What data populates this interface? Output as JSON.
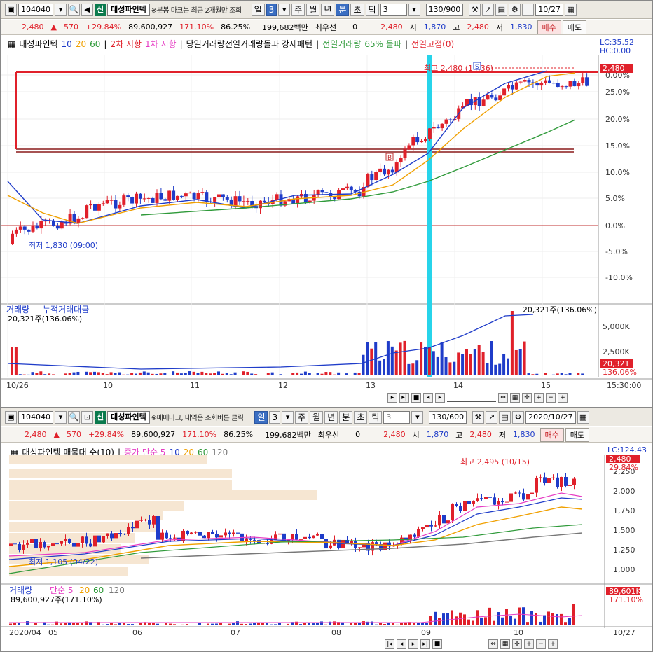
{
  "top": {
    "toolbar": {
      "code": "104040",
      "sin": "신",
      "name": "대성파인텍",
      "note": "※분봉 마크는 최근 2개월만 조회",
      "tab_day": "일",
      "period": "3",
      "tab_week": "주",
      "tab_month": "월",
      "tab_year": "년",
      "tab_min": "분",
      "tab_sec": "초",
      "tab_tick": "틱",
      "unit": "3",
      "count": "130/900",
      "date": "10/27"
    },
    "quote": {
      "price": "2,480",
      "change": "570",
      "rate": "+29.84%",
      "volume": "89,600,927",
      "vol_ratio": "171.10%",
      "turnover": "86.25%",
      "amount": "199,682백만",
      "best": "최우선",
      "best_val": "0",
      "ask": "2,480",
      "open_l": "시",
      "open": "1,870",
      "high_l": "고",
      "high": "2,480",
      "low_l": "저",
      "low": "1,830",
      "buy": "매수",
      "sell": "매도"
    },
    "legend": {
      "name": "대성파인텍",
      "ma10": "10",
      "ma20": "20",
      "ma60": "60",
      "l2": "2차 저항",
      "l1": "1차 저항",
      "pattern": "당일거래량전일거래량돌파 강세패턴",
      "vol": "전일거래량",
      "pct": "65% 돌파",
      "prev": "전일고점(0)"
    },
    "lc": "LC:35.52",
    "hc": "HC:0.00",
    "price_axis": [
      "0.00%",
      "25.0%",
      "20.0%",
      "15.0%",
      "10.0%",
      "5.0%",
      "0.0%",
      "-5.0%",
      "-10.0%"
    ],
    "price_tag": "2,480",
    "high_note": "최고 2,480 (14:36)",
    "low_note": "최저 1,830 (09:00)",
    "vol_legend": {
      "a": "거래량",
      "b": "누적거래대금",
      "val": "20,321주(136.06%)",
      "right": "20,321주(136.06%)"
    },
    "vol_axis": [
      "5,000K",
      "2,500K"
    ],
    "vol_tag": "20,321",
    "vol_tag2": "136.06%",
    "dates": [
      "10/26",
      "10",
      "11",
      "12",
      "13",
      "14",
      "15"
    ],
    "time": "15:30:00"
  },
  "bottom": {
    "toolbar": {
      "code": "104040",
      "sin": "신",
      "name": "대성파인텍",
      "note": "※매매마크, 내역은 조회버튼 클릭",
      "tab_day": "일",
      "period": "3",
      "tab_week": "주",
      "tab_month": "월",
      "tab_year": "년",
      "tab_min": "분",
      "tab_sec": "초",
      "tab_tick": "틱",
      "unit": "3",
      "count": "130/600",
      "date": "2020/10/27"
    },
    "quote": {
      "price": "2,480",
      "change": "570",
      "rate": "+29.84%",
      "volume": "89,600,927",
      "vol_ratio": "171.10%",
      "turnover": "86.25%",
      "amount": "199,682백만",
      "best": "최우선",
      "best_val": "0",
      "ask": "2,480",
      "open_l": "시",
      "open": "1,870",
      "high_l": "고",
      "high": "2,480",
      "low_l": "저",
      "low": "1,830",
      "buy": "매수",
      "sell": "매도"
    },
    "legend": {
      "name": "대성파인텍 매물대 수(10)",
      "ma": "종가 단순 5",
      "m10": "10",
      "m20": "20",
      "m60": "60",
      "m120": "120"
    },
    "lc": "LC:124.43",
    "price_tag": "2,480",
    "price_tag2": "29.84%",
    "price_axis": [
      "2,250",
      "2,000",
      "1,750",
      "1,500",
      "1,250",
      "1,000"
    ],
    "high_note": "최고 2,495 (10/15)",
    "low_note": "최저 1,105 (04/22)",
    "vol_legend": {
      "a": "거래량",
      "b": "단순 5",
      "c": "20",
      "d": "60",
      "e": "120",
      "val": "89,600,927주(171.10%)"
    },
    "vol_tag": "89,601K",
    "vol_tag2": "171.10%",
    "dates": [
      "2020/04",
      "05",
      "06",
      "07",
      "08",
      "09",
      "10",
      "10/27"
    ]
  },
  "colors": {
    "up": "#e0202a",
    "down": "#1f3cc9",
    "ma5": "#e63cc4",
    "ma10": "#1f3cc9",
    "ma20": "#f0a000",
    "ma60": "#2f9a3a",
    "ma120": "#777777",
    "cyan": "#27d4ea",
    "resist": "#8a1a1a"
  }
}
